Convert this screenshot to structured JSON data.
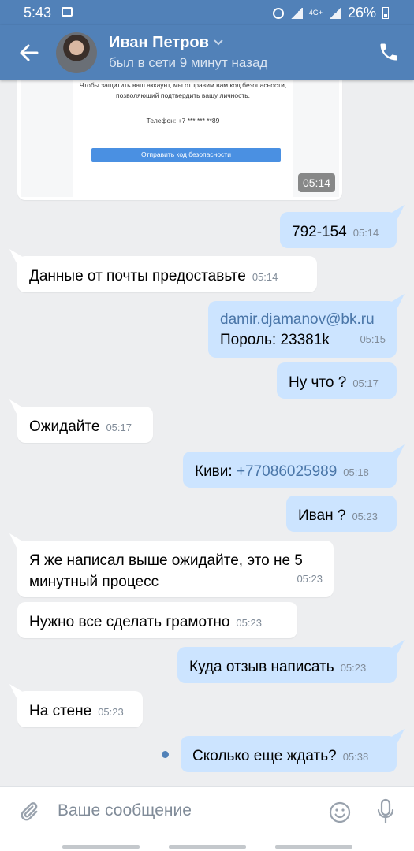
{
  "status_bar": {
    "time": "5:43",
    "battery": "26%",
    "network": "4G+"
  },
  "header": {
    "contact_name": "Иван Петров",
    "last_seen": "был в сети 9 минут назад"
  },
  "attachment": {
    "text": "Чтобы защитить ваш аккаунт, мы отправим вам код безопасности, позволяющий подтвердить вашу личность.",
    "phone": "Телефон: +7 *** *** **89",
    "button": "Отправить код безопасности",
    "time": "05:14"
  },
  "messages": [
    {
      "dir": "out",
      "text": "792-154",
      "time": "05:14"
    },
    {
      "dir": "in",
      "text": "Данные от почты предоставьте",
      "time": "05:14"
    },
    {
      "dir": "out",
      "text_link": "damir.djamanov@bk.ru",
      "text": "Пороль: 23381k",
      "time": "05:15"
    },
    {
      "dir": "out",
      "text": "Ну что ?",
      "time": "05:17"
    },
    {
      "dir": "in",
      "text": "Ожидайте",
      "time": "05:17"
    },
    {
      "dir": "out",
      "prefix": "Киви: ",
      "text_link": "+77086025989",
      "time": "05:18"
    },
    {
      "dir": "out",
      "text": "Иван ?",
      "time": "05:23"
    },
    {
      "dir": "in",
      "text": "Я же написал выше ожидайте, это не 5 минутный процесс",
      "time": "05:23"
    },
    {
      "dir": "in",
      "text": "Нужно все сделать грамотно",
      "time": "05:23"
    },
    {
      "dir": "out",
      "text": "Куда отзыв написать",
      "time": "05:23"
    },
    {
      "dir": "in",
      "text": "На стене",
      "time": "05:23"
    },
    {
      "dir": "out",
      "text": "Сколько еще ждать?",
      "time": "05:38"
    }
  ],
  "composer": {
    "placeholder": "Ваше сообщение"
  },
  "colors": {
    "header": "#5181b8",
    "outgoing": "#cce4ff",
    "incoming": "#ffffff",
    "background": "#edeef0",
    "link": "#4a76a8"
  },
  "icons": [
    "back-arrow-icon",
    "avatar",
    "chevron-down-icon",
    "phone-icon",
    "paperclip-icon",
    "smile-icon",
    "microphone-icon"
  ]
}
